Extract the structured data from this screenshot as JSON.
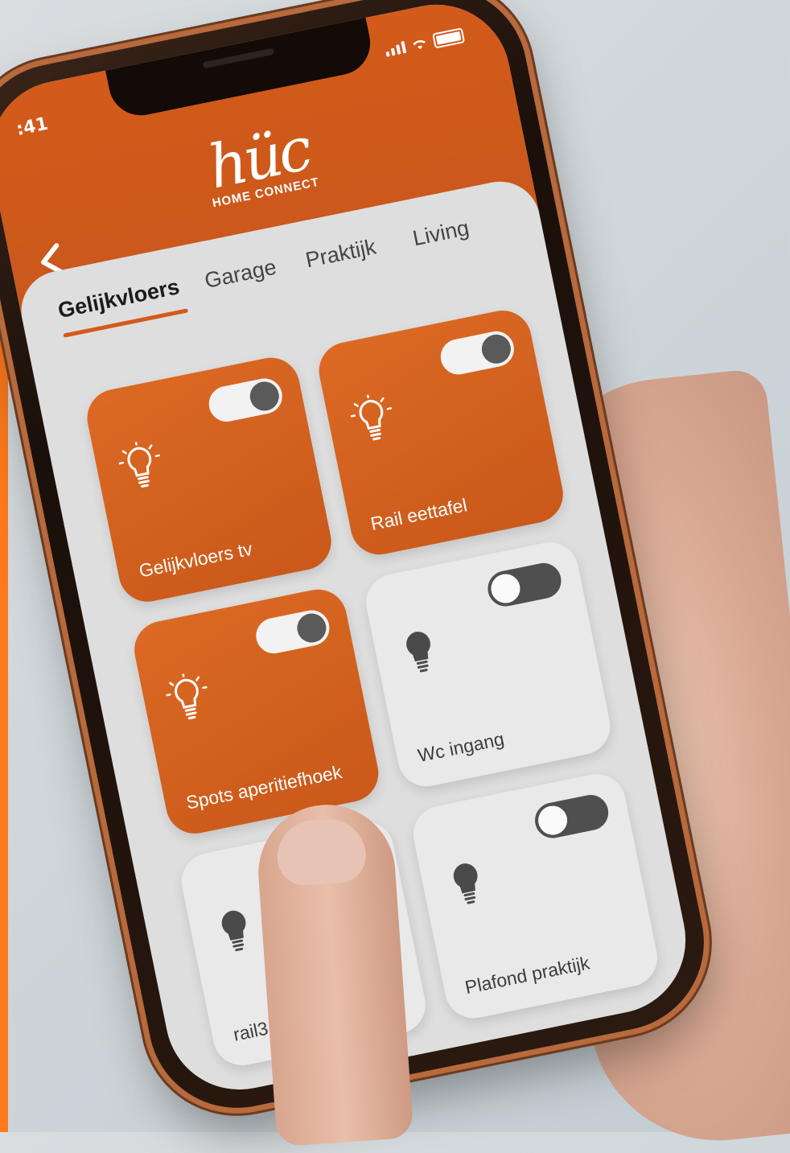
{
  "status_bar": {
    "time": ":41"
  },
  "logo": {
    "mark": "hüc",
    "subtitle": "HOME CONNECT"
  },
  "tabs": [
    {
      "label": "Gelijkvloers",
      "active": true
    },
    {
      "label": "Garage",
      "active": false
    },
    {
      "label": "Praktijk",
      "active": false
    },
    {
      "label": "Living",
      "active": false
    }
  ],
  "devices": [
    {
      "label": "Gelijkvloers tv",
      "on": true,
      "icon": "light-bulb-icon"
    },
    {
      "label": "Rail eettafel",
      "on": true,
      "icon": "light-bulb-icon"
    },
    {
      "label": "Spots aperitiefhoek",
      "on": true,
      "icon": "light-bulb-icon"
    },
    {
      "label": "Wc ingang",
      "on": false,
      "icon": "light-bulb-icon"
    },
    {
      "label": "rail3",
      "on": false,
      "icon": "light-bulb-icon"
    },
    {
      "label": "Plafond praktijk",
      "on": false,
      "icon": "light-bulb-icon"
    }
  ],
  "colors": {
    "accent": "#d35a1a",
    "tile_off": "#e9e9e9",
    "toggle_off": "#4f4f4f"
  }
}
